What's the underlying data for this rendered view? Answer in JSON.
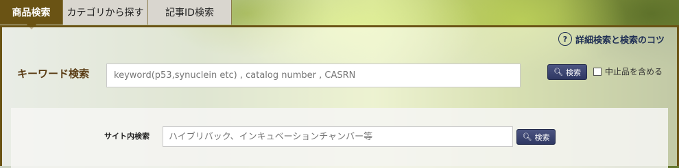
{
  "tabs": [
    {
      "label": "商品検索",
      "active": true
    },
    {
      "label": "カテゴリから探す",
      "active": false
    },
    {
      "label": "記事ID検索",
      "active": false
    }
  ],
  "tips": {
    "icon": "?",
    "label": "詳細検索と検索のコツ"
  },
  "keyword": {
    "label": "キーワード検索",
    "placeholder": "keyword(p53,synuclein etc) , catalog number , CASRN",
    "button_label": "検索",
    "discontinued_label": "中止品を含める"
  },
  "site_search": {
    "label": "サイト内検索",
    "placeholder": "ハイブリバック、インキュベーションチャンバー等",
    "button_label": "検索"
  },
  "colors": {
    "tab_active": "#6a5314",
    "button": "#2f3863",
    "link": "#1e2e54"
  }
}
